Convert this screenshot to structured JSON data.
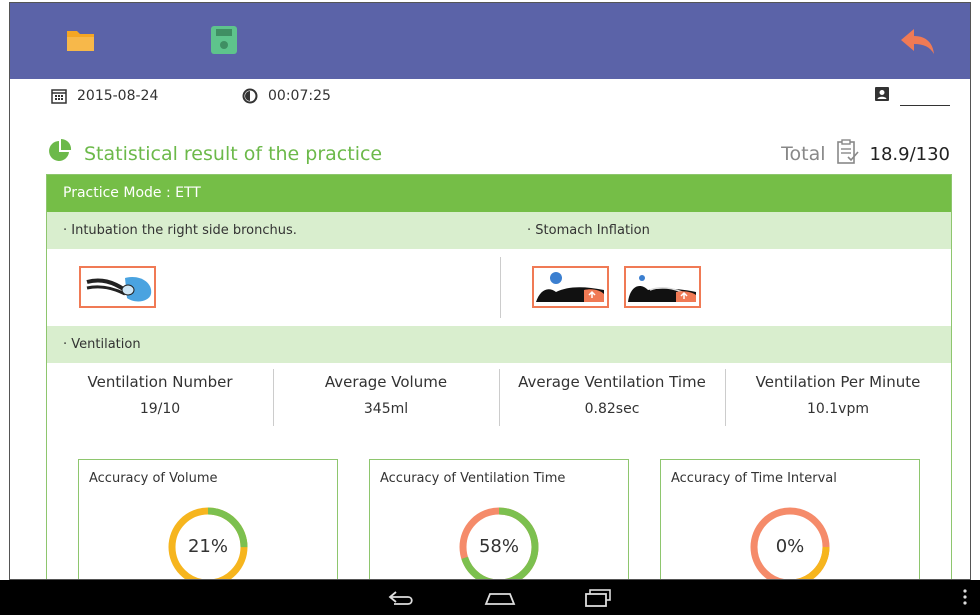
{
  "header": {
    "date": "2015-08-24",
    "time": "00:07:25",
    "user_name": ""
  },
  "section": {
    "title": "Statistical result of the practice",
    "total_label": "Total",
    "total_value": "18.9/130"
  },
  "mode": {
    "label": "Practice Mode : ETT"
  },
  "issues": {
    "left_label": "· Intubation the right side bronchus.",
    "right_label": "· Stomach Inflation"
  },
  "ventilation": {
    "label": "· Ventilation",
    "stats": [
      {
        "label": "Ventilation Number",
        "value": "19/10"
      },
      {
        "label": "Average Volume",
        "value": "345ml"
      },
      {
        "label": "Average Ventilation Time",
        "value": "0.82sec"
      },
      {
        "label": "Ventilation Per Minute",
        "value": "10.1vpm"
      }
    ]
  },
  "accuracy": [
    {
      "title": "Accuracy of Volume",
      "percent_text": "21%",
      "percent": 21
    },
    {
      "title": "Accuracy of Ventilation Time",
      "percent_text": "58%",
      "percent": 58
    },
    {
      "title": "Accuracy of Time Interval",
      "percent_text": "0%",
      "percent": 0
    }
  ],
  "icons": {
    "folder": "folder-icon",
    "save": "save-icon",
    "back": "back-arrow-icon",
    "calendar": "calendar-icon",
    "clock": "clock-icon",
    "user": "user-card-icon",
    "pie": "pie-chart-icon",
    "clipboard": "clipboard-check-icon"
  },
  "colors": {
    "topbar": "#5b63a8",
    "green": "#75be47",
    "light_green": "#d9eece",
    "orange": "#f07a55",
    "ring_green": "#7cc04f",
    "ring_yellow": "#f6b51e",
    "ring_orange": "#f58b6a"
  }
}
